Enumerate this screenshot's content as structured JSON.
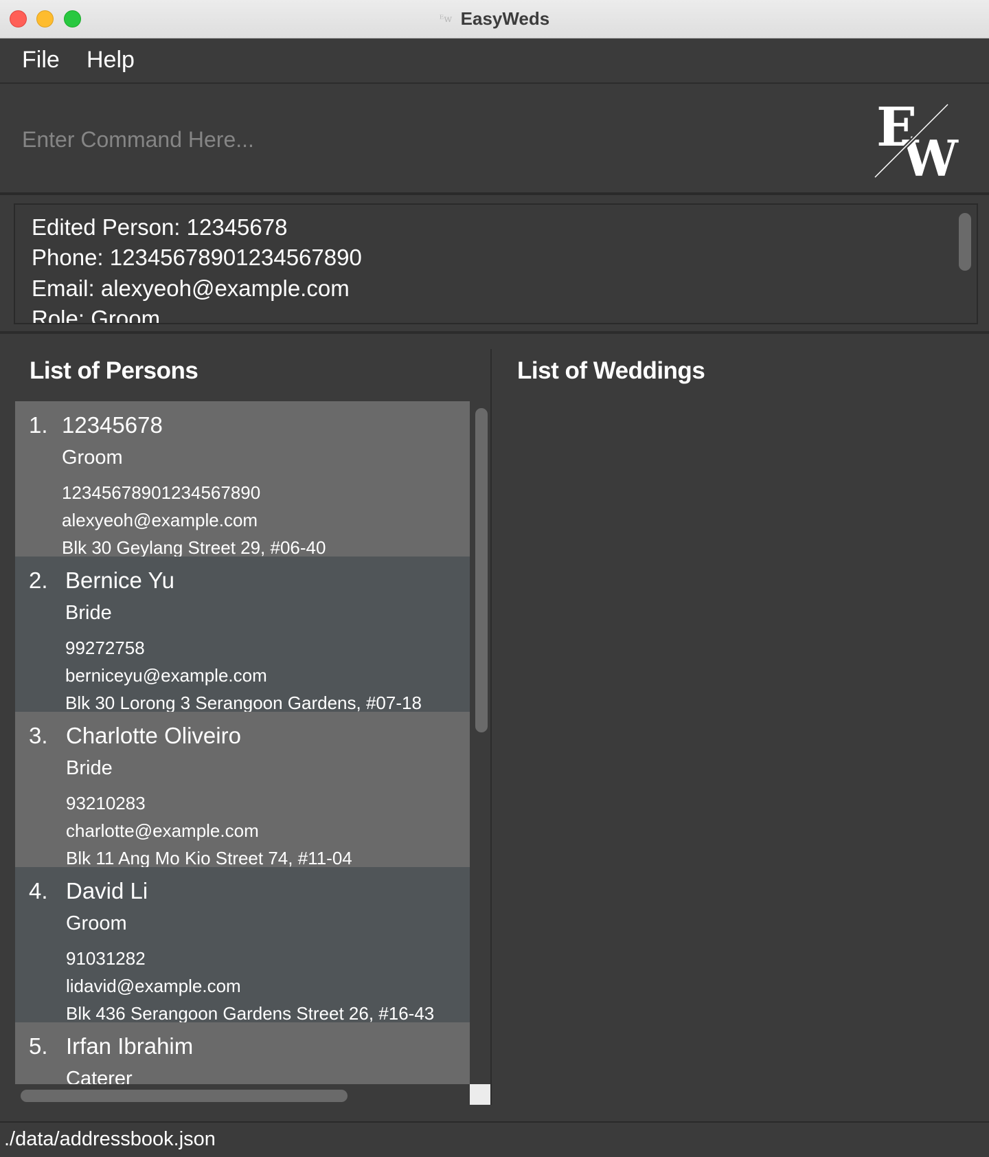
{
  "window": {
    "title": "EasyWeds"
  },
  "menu": {
    "file": "File",
    "help": "Help"
  },
  "command": {
    "placeholder": "Enter Command Here..."
  },
  "logo": {
    "letter_e": "E",
    "letter_w": "W"
  },
  "result": {
    "lines": [
      "Edited Person: 12345678",
      "Phone: 12345678901234567890",
      "Email: alexyeoh@example.com",
      "Role: Groom"
    ]
  },
  "persons_panel": {
    "heading": "List of Persons",
    "items": [
      {
        "index": "1.",
        "name": "12345678",
        "role": "Groom",
        "phone": "12345678901234567890",
        "email": "alexyeoh@example.com",
        "address": "Blk 30 Geylang Street 29, #06-40"
      },
      {
        "index": "2.",
        "name": "Bernice Yu",
        "role": "Bride",
        "phone": "99272758",
        "email": "berniceyu@example.com",
        "address": "Blk 30 Lorong 3 Serangoon Gardens, #07-18"
      },
      {
        "index": "3.",
        "name": "Charlotte Oliveiro",
        "role": "Bride",
        "phone": "93210283",
        "email": "charlotte@example.com",
        "address": "Blk 11 Ang Mo Kio Street 74, #11-04"
      },
      {
        "index": "4.",
        "name": "David Li",
        "role": "Groom",
        "phone": "91031282",
        "email": "lidavid@example.com",
        "address": "Blk 436 Serangoon Gardens Street 26, #16-43"
      },
      {
        "index": "5.",
        "name": "Irfan Ibrahim",
        "role": "Caterer"
      }
    ]
  },
  "weddings_panel": {
    "heading": "List of Weddings"
  },
  "statusbar": {
    "path": "./data/addressbook.json"
  },
  "colors": {
    "background": "#3b3b3b",
    "card_odd": "#6a6a6a",
    "card_even": "#505558",
    "close": "#ff5f57",
    "minimize": "#febc2e",
    "maximize": "#28c840"
  }
}
